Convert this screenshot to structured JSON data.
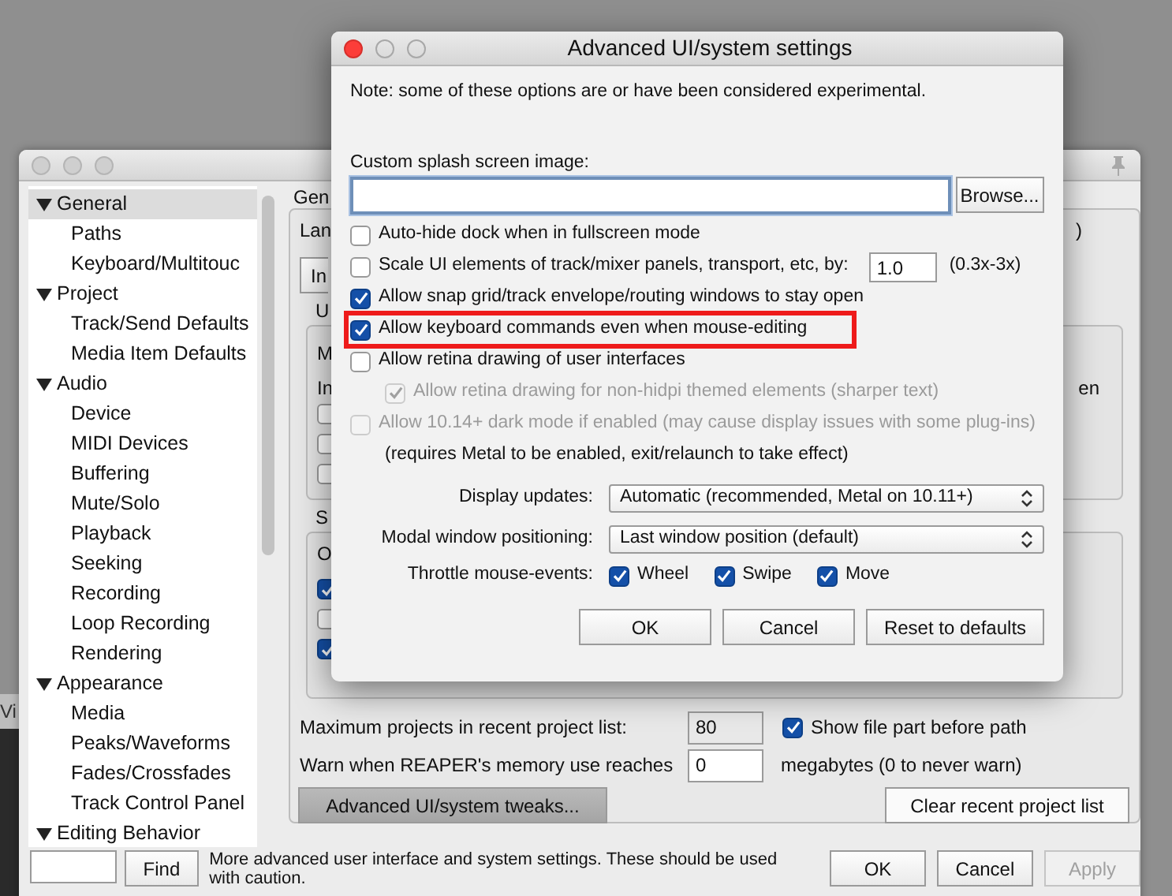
{
  "side_window": {
    "title": "Vi"
  },
  "preferences": {
    "sidebar": {
      "items": [
        {
          "label": "General",
          "expanded": true,
          "selected": true,
          "children": [
            {
              "label": "Paths",
              "selected": false
            },
            {
              "label": "Keyboard/Multitouc",
              "selected": false
            }
          ]
        },
        {
          "label": "Project",
          "expanded": true,
          "selected": false,
          "children": [
            {
              "label": "Track/Send Defaults",
              "selected": false
            },
            {
              "label": "Media Item Defaults",
              "selected": false
            }
          ]
        },
        {
          "label": "Audio",
          "expanded": true,
          "selected": false,
          "children": [
            {
              "label": "Device",
              "selected": false
            },
            {
              "label": "MIDI Devices",
              "selected": false
            },
            {
              "label": "Buffering",
              "selected": false
            },
            {
              "label": "Mute/Solo",
              "selected": false
            },
            {
              "label": "Playback",
              "selected": false
            },
            {
              "label": "Seeking",
              "selected": false
            },
            {
              "label": "Recording",
              "selected": false
            },
            {
              "label": "Loop Recording",
              "selected": false
            },
            {
              "label": "Rendering",
              "selected": false
            }
          ]
        },
        {
          "label": "Appearance",
          "expanded": true,
          "selected": false,
          "children": [
            {
              "label": "Media",
              "selected": false
            },
            {
              "label": "Peaks/Waveforms",
              "selected": false
            },
            {
              "label": "Fades/Crossfades",
              "selected": false
            },
            {
              "label": "Track Control Panel",
              "selected": false
            }
          ]
        },
        {
          "label": "Editing Behavior",
          "expanded": true,
          "selected": false
        }
      ]
    },
    "panel": {
      "section_title": "Gen",
      "language_label": "Lan",
      "language_suffix": ")",
      "button_fragment": "In",
      "group_1": {
        "title": "U",
        "label_1": "M",
        "label_2": "In",
        "right_text": "en",
        "checkboxes": [
          {
            "checked": false
          },
          {
            "checked": false
          },
          {
            "checked": false
          }
        ]
      },
      "group_2": {
        "title": "S",
        "label": "O",
        "checkboxes": [
          {
            "checked": true
          },
          {
            "checked": false
          },
          {
            "checked": true
          }
        ]
      },
      "max_projects": {
        "label": "Maximum projects in recent project list:",
        "value": "80"
      },
      "show_file_part": {
        "label": "Show file part before path",
        "checked": true
      },
      "memory_warn": {
        "label": "Warn when REAPER's memory use reaches",
        "value": "0",
        "unit": "megabytes (0 to never warn)"
      },
      "tweaks_button": "Advanced UI/system tweaks...",
      "clear_button": "Clear recent project list"
    },
    "find_button": "Find",
    "hint": "More advanced user interface and system settings. These should be used with caution.",
    "buttons": [
      {
        "label": "OK",
        "disabled": false
      },
      {
        "label": "Cancel",
        "disabled": false
      },
      {
        "label": "Apply",
        "disabled": true
      }
    ]
  },
  "dialog": {
    "title": "Advanced UI/system settings",
    "note": "Note: some of these options are or have been considered experimental.",
    "splash": {
      "label": "Custom splash screen image:",
      "browse": "Browse..."
    },
    "options": [
      {
        "kind": "checkbox",
        "label": "Auto-hide dock when in fullscreen mode",
        "checked": false,
        "disabled": false,
        "highlighted": false
      },
      {
        "kind": "scale",
        "label": "Scale UI elements of track/mixer panels, transport, etc, by:",
        "checked": false,
        "disabled": false,
        "highlighted": false,
        "value": "1.0",
        "range": "(0.3x-3x)"
      },
      {
        "kind": "checkbox",
        "label": "Allow snap grid/track envelope/routing windows to stay open",
        "checked": true,
        "disabled": false,
        "highlighted": false
      },
      {
        "kind": "checkbox",
        "label": "Allow keyboard commands even when mouse-editing",
        "checked": true,
        "disabled": false,
        "highlighted": true
      },
      {
        "kind": "checkbox",
        "label": "Allow retina drawing of user interfaces",
        "checked": false,
        "disabled": false,
        "highlighted": false
      },
      {
        "kind": "sub",
        "label": "Allow retina drawing for non-hidpi themed elements (sharper text)",
        "checked": true,
        "disabled": true,
        "highlighted": false
      },
      {
        "kind": "checkbox",
        "label": "Allow 10.14+ dark mode if enabled (may cause display issues with some plug-ins)",
        "checked": false,
        "disabled": true,
        "highlighted": false
      },
      {
        "kind": "note",
        "label": "(requires Metal to be enabled, exit/relaunch to take effect)"
      }
    ],
    "selects": [
      {
        "label": "Display updates:",
        "value": "Automatic (recommended, Metal on 10.11+)"
      },
      {
        "label": "Modal window positioning:",
        "value": "Last window position (default)"
      }
    ],
    "throttle": {
      "label": "Throttle mouse-events:",
      "options": [
        {
          "label": "Wheel",
          "checked": true
        },
        {
          "label": "Swipe",
          "checked": true
        },
        {
          "label": "Move",
          "checked": true
        }
      ]
    },
    "buttons": [
      "OK",
      "Cancel",
      "Reset to defaults"
    ]
  }
}
